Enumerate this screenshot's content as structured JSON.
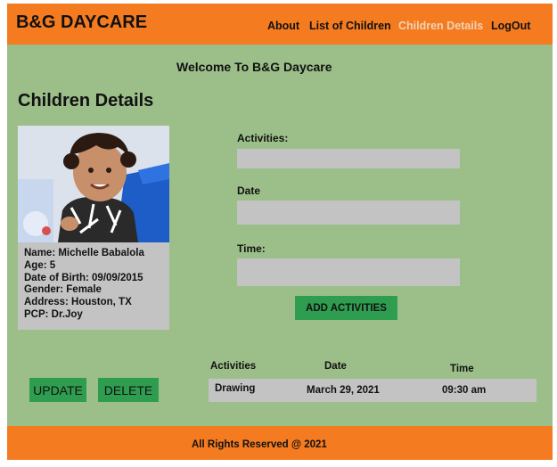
{
  "header": {
    "brand": "B&G DAYCARE",
    "nav": [
      {
        "label": "About"
      },
      {
        "label": "List of Children"
      },
      {
        "label": "Children Details",
        "active": true
      },
      {
        "label": "LogOut"
      }
    ]
  },
  "welcome": "Welcome To B&G Daycare",
  "page_title": "Children Details",
  "child": {
    "photo_icon": "child-photo",
    "name": "Name: Michelle Babalola",
    "age": "Age: 5",
    "dob": "Date of Birth: 09/09/2015",
    "gender": "Gender: Female",
    "address": "Address: Houston, TX",
    "pcp": "PCP: Dr.Joy"
  },
  "form": {
    "activities_label": "Activities:",
    "date_label": "Date",
    "time_label": "Time:",
    "activities_value": "",
    "date_value": "",
    "time_value": "",
    "add_button": "ADD ACTIVITIES"
  },
  "actions": {
    "update": "UPDATE",
    "delete": "DELETE"
  },
  "table": {
    "headers": [
      "Activities",
      "Date",
      "Time"
    ],
    "rows": [
      [
        "Drawing",
        "March 29, 2021",
        "09:30 am"
      ]
    ]
  },
  "footer": "All Rights Reserved @ 2021",
  "colors": {
    "header": "#f47b20",
    "background": "#9cbf8a",
    "button": "#2f9d50",
    "field": "#c3c3c3",
    "active_nav": "#f1d3b5"
  }
}
